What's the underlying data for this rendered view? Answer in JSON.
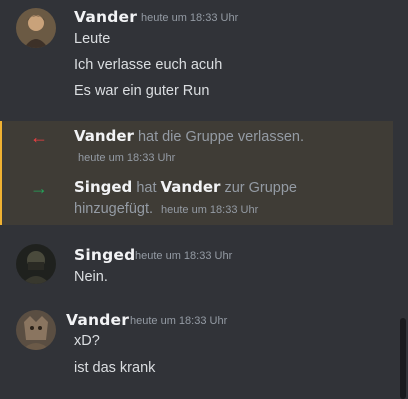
{
  "messages": [
    {
      "author": "Vander",
      "timestamp": "heute um 18:33 Uhr",
      "lines": [
        "Leute",
        "Ich verlasse euch acuh",
        "Es war ein guter Run"
      ]
    },
    {
      "author": "Singed",
      "timestamp": "heute um 18:33 Uhr",
      "lines": [
        "Nein."
      ]
    },
    {
      "author": "Vander",
      "timestamp": "heute um 18:33 Uhr",
      "lines": [
        "xD?",
        "ist das krank"
      ]
    }
  ],
  "system": {
    "leave": {
      "user": "Vander",
      "text": "hat die Gruppe verlassen.",
      "timestamp": "heute um 18:33 Uhr",
      "color": "#f23f43"
    },
    "add": {
      "actor": "Singed",
      "word_hat": "hat",
      "target": "Vander",
      "text1": "zur Gruppe",
      "text2": "hinzugefügt.",
      "timestamp": "heute um 18:33 Uhr",
      "color": "#23a55a"
    },
    "highlight_color": "#f0b232"
  }
}
